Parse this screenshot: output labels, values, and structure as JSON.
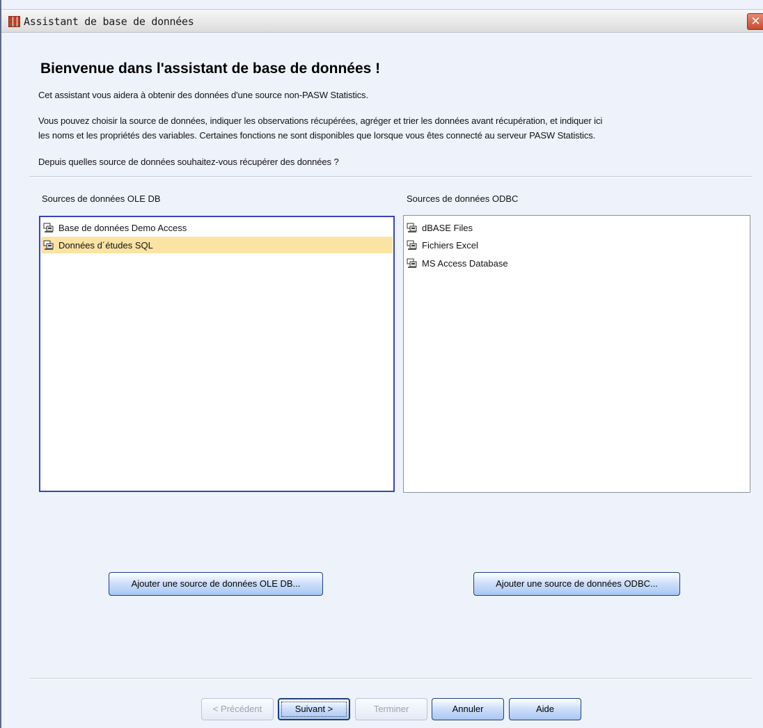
{
  "window": {
    "title": "Assistant de base de données",
    "close_glyph": "✕"
  },
  "content": {
    "heading": "Bienvenue dans l'assistant de base de données !",
    "intro": "Cet assistant vous aidera à obtenir des données d'une source non-PASW Statistics.",
    "description_line1": "Vous pouvez choisir la source de données, indiquer les observations récupérées, agréger et trier les données avant récupération, et indiquer ici",
    "description_line2": "les noms et les propriétés des variables. Certaines fonctions ne sont disponibles que lorsque vous êtes connecté au serveur PASW Statistics.",
    "question": "Depuis quelles source de données souhaitez-vous récupérer des données ?"
  },
  "ole_db": {
    "label": "Sources de données OLE DB",
    "items": [
      {
        "label": "Base de données Demo Access",
        "icon": "database-icon",
        "selected": false
      },
      {
        "label": "Données d´études SQL",
        "icon": "database-icon",
        "selected": true
      }
    ],
    "add_button": "Ajouter une source de données OLE DB..."
  },
  "odbc": {
    "label": "Sources de données ODBC",
    "items": [
      {
        "label": "dBASE Files",
        "icon": "database-icon"
      },
      {
        "label": "Fichiers Excel",
        "icon": "database-icon"
      },
      {
        "label": "MS Access Database",
        "icon": "database-icon"
      }
    ],
    "add_button": "Ajouter une source de données ODBC..."
  },
  "footer": {
    "previous": "< Précédent",
    "next": "Suivant >",
    "finish": "Terminer",
    "cancel": "Annuler",
    "help": "Aide"
  },
  "colors": {
    "selection": "#fbe3a3",
    "focus_border": "#3a43c0",
    "button_border": "#1d3f7a",
    "window_bg": "#eef2fb"
  }
}
